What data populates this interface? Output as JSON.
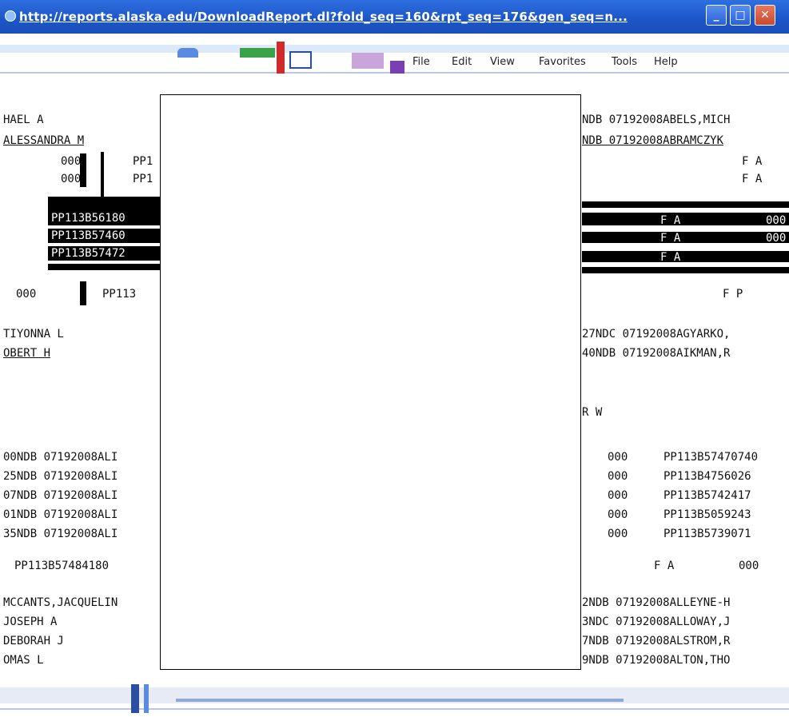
{
  "window": {
    "title": "http://reports.alaska.edu/DownloadReport.dl?fold_seq=160&rpt_seq=176&gen_seq=n...",
    "minimize_glyph": "_",
    "maximize_glyph": "□",
    "close_glyph": "✕"
  },
  "menu": {
    "items": [
      "File",
      "Edit",
      "View",
      "Favorites",
      "Tools",
      "Help"
    ]
  },
  "report": {
    "left_lines": [
      "HAEL A",
      "ALESSANDRA M",
      "TIYONNA L",
      "OBERT H",
      "MCCANTS,JACQUELIN",
      "JOSEPH A",
      "DEBORAH J",
      "OMAS L"
    ],
    "right_lines": [
      "NDB 07192008ABELS,MICH",
      "NDB 07192008ABRAMCZYK",
      "27NDC 07192008AGYARKO,",
      "40NDB 07192008AIKMAN,R",
      "2NDB 07192008ALLEYNE-H",
      "3NDC 07192008ALLOWAY,J",
      "7NDB 07192008ALSTROM,R",
      "9NDB 07192008ALTON,THO"
    ],
    "code_rows": [
      {
        "left": "000",
        "right": "PP1",
        "flag": "F A"
      },
      {
        "left": "000",
        "right": "PP1",
        "flag": "F A"
      }
    ],
    "black_rows": [
      "PP113B56180",
      "PP113B57460",
      "PP113B57472"
    ],
    "mid_row": {
      "left": "000",
      "right": "PP113",
      "flag": "F P"
    },
    "ndb_rows": [
      {
        "left": "00NDB 07192008ALI",
        "mid": "000",
        "pp": "PP113B57470740"
      },
      {
        "left": "25NDB 07192008ALI",
        "mid": "000",
        "pp": "PP113B4756026"
      },
      {
        "left": "07NDB 07192008ALI",
        "mid": "000",
        "pp": "PP113B5742417"
      },
      {
        "left": "01NDB 07192008ALI",
        "mid": "000",
        "pp": "PP113B5059243"
      },
      {
        "left": "35NDB 07192008ALI",
        "mid": "000",
        "pp": "PP113B5739071"
      }
    ],
    "pp_line": "PP113B57484180",
    "pp_flag": "F A",
    "pp_code": "000",
    "small_labels": [
      "F A",
      "F A",
      "F A",
      "000",
      "000",
      "R W"
    ]
  },
  "colors": {
    "titlebar": "#1b55c8",
    "title_text": "#ffffff",
    "close": "#c94a2e"
  }
}
